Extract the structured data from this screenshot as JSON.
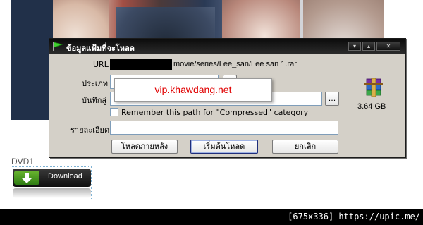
{
  "dialog": {
    "title": "ข้อมูลแฟ้มที่จะโหลด",
    "window_controls": [
      "▾",
      "▴",
      "✕"
    ],
    "url_label": "URL",
    "url_value": "movie/series/Lee_san/Lee san 1.rar",
    "type_label": "ประเภท",
    "save_label": "บันทึกสู่",
    "browse_label": "...",
    "remember_label": "Remember this path for \"Compressed\" category",
    "desc_label": "รายละเอียด",
    "file_size": "3.64  GB",
    "buttons": {
      "later": "โหลดภายหลัง",
      "start": "เริ่มต้นโหลด",
      "cancel": "ยกเลิก"
    },
    "icon": "winrar-archive-icon"
  },
  "watermark": "vip.khawdang.net",
  "dvd": {
    "label": "DVD1",
    "download_label": "Download"
  },
  "footer": {
    "upic_text": "[675x336] https://upic.me/"
  },
  "colors": {
    "dialog_bg": "#d4d0c8",
    "titlebar": "#111111",
    "watermark_text": "#e00000",
    "download_green": "#4a9a22"
  }
}
